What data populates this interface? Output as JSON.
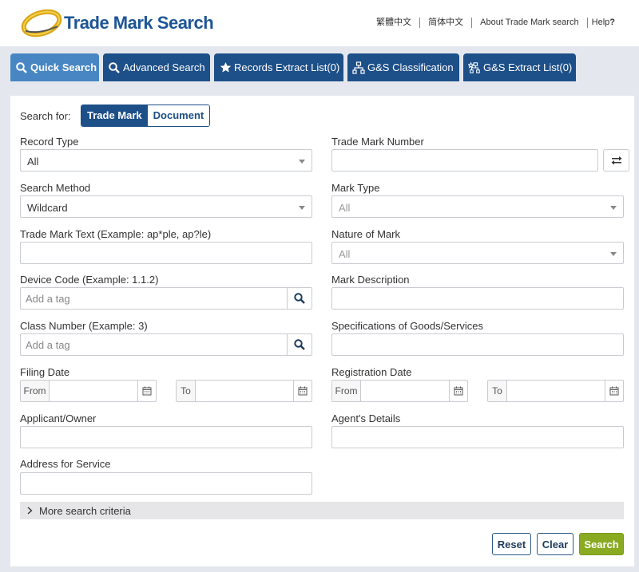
{
  "header": {
    "title": "Trade Mark Search",
    "links": [
      "繁體中文",
      "简体中文",
      "About Trade Mark search"
    ],
    "help_label": "Help",
    "help_mark": "?"
  },
  "tabs": [
    {
      "label": "Quick Search",
      "icon": "search-icon",
      "active": true
    },
    {
      "label": "Advanced Search",
      "icon": "search-icon",
      "active": false
    },
    {
      "label": "Records Extract List(0)",
      "icon": "star-icon",
      "active": false
    },
    {
      "label": "G&S Classification",
      "icon": "hierarchy-icon",
      "active": false
    },
    {
      "label": "G&S Extract List(0)",
      "icon": "star-hierarchy-icon",
      "active": false
    }
  ],
  "form": {
    "search_for_label": "Search for:",
    "search_for_options": [
      "Trade Mark",
      "Document"
    ],
    "search_for_selected": "Trade Mark",
    "record_type": {
      "label": "Record Type",
      "value": "All"
    },
    "trade_mark_number": {
      "label": "Trade Mark Number",
      "value": ""
    },
    "search_method": {
      "label": "Search Method",
      "value": "Wildcard"
    },
    "mark_type": {
      "label": "Mark Type",
      "value": "All"
    },
    "trade_mark_text": {
      "label": "Trade Mark Text (Example: ap*ple, ap?le)",
      "value": ""
    },
    "nature_of_mark": {
      "label": "Nature of Mark",
      "value": "All"
    },
    "device_code": {
      "label": "Device Code (Example: 1.1.2)",
      "placeholder": "Add a tag"
    },
    "mark_description": {
      "label": "Mark Description",
      "value": ""
    },
    "class_number": {
      "label": "Class Number (Example: 3)",
      "placeholder": "Add a tag"
    },
    "specifications": {
      "label": "Specifications of Goods/Services",
      "value": ""
    },
    "filing_date": {
      "label": "Filing Date",
      "from_label": "From",
      "to_label": "To"
    },
    "registration_date": {
      "label": "Registration Date",
      "from_label": "From",
      "to_label": "To"
    },
    "applicant": {
      "label": "Applicant/Owner",
      "value": ""
    },
    "agent": {
      "label": "Agent's Details",
      "value": ""
    },
    "address": {
      "label": "Address for Service",
      "value": ""
    },
    "more_criteria": "More search criteria"
  },
  "buttons": {
    "reset": "Reset",
    "clear": "Clear",
    "search": "Search"
  },
  "colors": {
    "brand": "#1c5596",
    "tab": "#1d4f88",
    "tab_active": "#4886c3",
    "search_button": "#8aaa22"
  }
}
